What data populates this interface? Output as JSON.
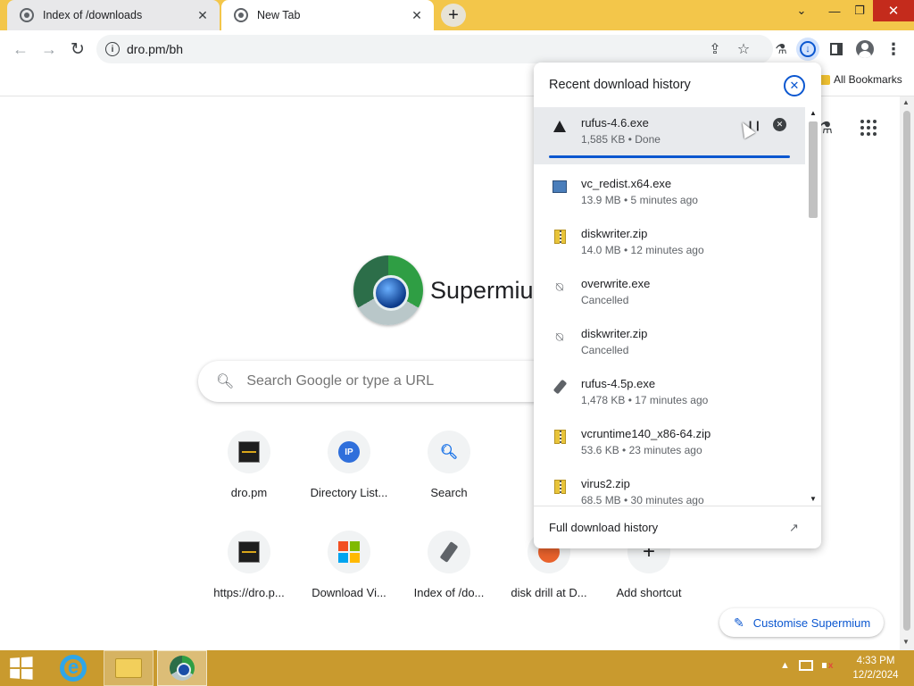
{
  "tabs": [
    {
      "title": "Index of /downloads",
      "active": false
    },
    {
      "title": "New Tab",
      "active": true
    }
  ],
  "toolbar": {
    "url": "dro.pm/bh"
  },
  "bookmarks_bar": {
    "all_bookmarks_label": "All Bookmarks"
  },
  "ntp": {
    "logo_text": "Supermium",
    "search_placeholder": "Search Google or type a URL",
    "customise_label": "Customise Supermium",
    "shortcuts": [
      {
        "label": "dro.pm",
        "icon": "dro-pm-icon"
      },
      {
        "label": "Directory List...",
        "icon": "ip-icon"
      },
      {
        "label": "Search",
        "icon": "search-icon"
      },
      {
        "label": "https://dro.p...",
        "icon": "dro-pm-icon"
      },
      {
        "label": "Download Vi...",
        "icon": "windows-icon"
      },
      {
        "label": "Index of /do...",
        "icon": "usb-drive-icon"
      },
      {
        "label": "disk drill at D...",
        "icon": "disk-drill-icon"
      },
      {
        "label": "Add shortcut",
        "icon": "plus-icon"
      }
    ]
  },
  "downloads": {
    "header": "Recent download history",
    "footer": "Full download history",
    "items": [
      {
        "name": "rufus-4.6.exe",
        "status": "1,585 KB • Done",
        "icon": "warning-icon",
        "progress": 1.0
      },
      {
        "name": "vc_redist.x64.exe",
        "status": "13.9 MB • 5 minutes ago",
        "icon": "installer-icon"
      },
      {
        "name": "diskwriter.zip",
        "status": "14.0 MB • 12 minutes ago",
        "icon": "zip-icon"
      },
      {
        "name": "overwrite.exe",
        "status": "Cancelled",
        "icon": "blocked-file-icon"
      },
      {
        "name": "diskwriter.zip",
        "status": "Cancelled",
        "icon": "blocked-file-icon"
      },
      {
        "name": "rufus-4.5p.exe",
        "status": "1,478 KB • 17 minutes ago",
        "icon": "usb-drive-icon"
      },
      {
        "name": "vcruntime140_x86-64.zip",
        "status": "53.6 KB • 23 minutes ago",
        "icon": "zip-icon"
      },
      {
        "name": "virus2.zip",
        "status": "68.5 MB • 30 minutes ago",
        "icon": "zip-icon"
      }
    ]
  },
  "taskbar": {
    "time": "4:33 PM",
    "date": "12/2/2024"
  },
  "colors": {
    "tabstrip": "#f3c64a",
    "accent": "#0b57d0",
    "taskbar": "#c99a2e",
    "close_button": "#c42b1c"
  }
}
